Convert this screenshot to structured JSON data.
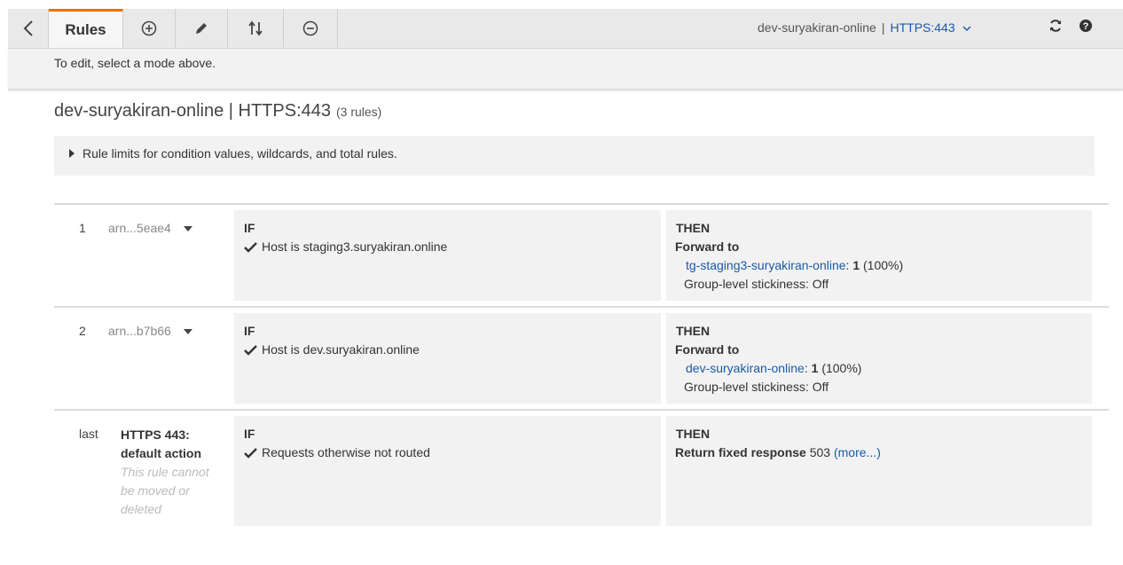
{
  "toolbar": {
    "back_icon": "chevron-left-icon",
    "rules_tab_label": "Rules",
    "add_icon": "plus-circle-icon",
    "edit_icon": "pencil-icon",
    "reorder_icon": "reorder-arrows-icon",
    "delete_icon": "minus-circle-icon",
    "lb_name": "dev-suryakiran-online",
    "separator": "|",
    "listener_selected": "HTTPS:443",
    "refresh_icon": "refresh-icon",
    "help_icon": "help-icon",
    "accent_color": "#ec7211"
  },
  "hint": "To edit, select a mode above.",
  "header": {
    "title": "dev-suryakiran-online | HTTPS:443",
    "rule_count": "(3 rules)"
  },
  "limits": {
    "text": "Rule limits for condition values, wildcards, and total rules."
  },
  "rules": [
    {
      "number": "1",
      "arn": "arn...5eae4",
      "if_label": "IF",
      "condition": "Host is staging3.suryakiran.online",
      "then_label": "THEN",
      "action": "Forward to",
      "target_group": "tg-staging3-suryakiran-online",
      "target_sep": ":",
      "weight": "1",
      "weight_pct": "(100%)",
      "stickiness": "Group-level stickiness: Off"
    },
    {
      "number": "2",
      "arn": "arn...b7b66",
      "if_label": "IF",
      "condition": "Host is dev.suryakiran.online",
      "then_label": "THEN",
      "action": "Forward to",
      "target_group": "dev-suryakiran-online",
      "target_sep": ":",
      "weight": "1",
      "weight_pct": "(100%)",
      "stickiness": "Group-level stickiness: Off"
    }
  ],
  "default_rule": {
    "number": "last",
    "title": "HTTPS 443: default action",
    "note": "This rule cannot be moved or deleted",
    "if_label": "IF",
    "condition": "Requests otherwise not routed",
    "then_label": "THEN",
    "action": "Return fixed response",
    "status_code": "503",
    "more_link": "(more...)"
  }
}
